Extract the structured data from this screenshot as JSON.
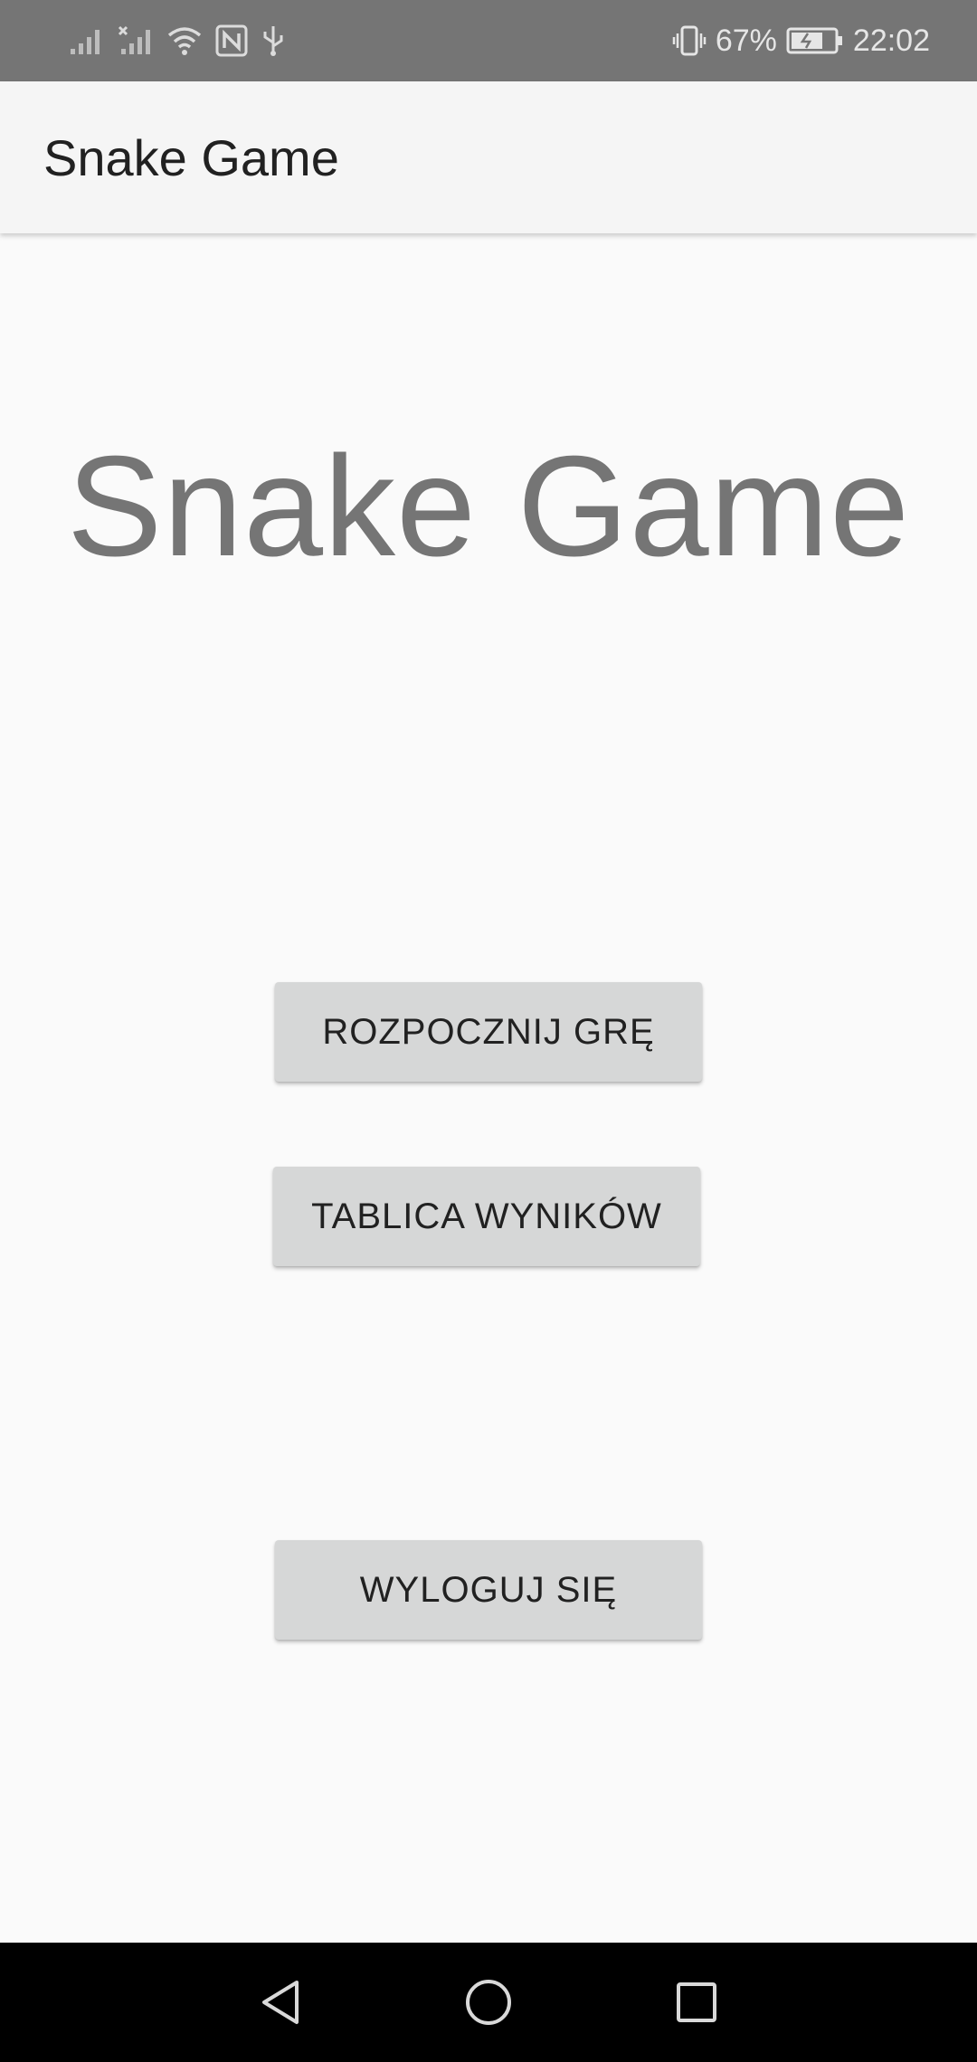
{
  "status_bar": {
    "battery_percent": "67%",
    "time": "22:02",
    "icons": [
      "signal-icon",
      "signal-no-sim-icon",
      "wifi-icon",
      "nfc-icon",
      "usb-icon",
      "vibrate-icon",
      "battery-charging-icon"
    ]
  },
  "app_bar": {
    "title": "Snake Game"
  },
  "main": {
    "hero_title": "Snake Game",
    "buttons": {
      "start": "ROZPOCZNIJ GRĘ",
      "scores": "TABLICA WYNIKÓW",
      "logout": "WYLOGUJ SIĘ"
    }
  },
  "nav_bar": {
    "icons": [
      "back-icon",
      "home-icon",
      "recents-icon"
    ]
  },
  "colors": {
    "status_bar": "#757575",
    "app_bar": "#f5f5f5",
    "background": "#fafafa",
    "button": "#d6d7d7",
    "hero_text": "#757575"
  }
}
